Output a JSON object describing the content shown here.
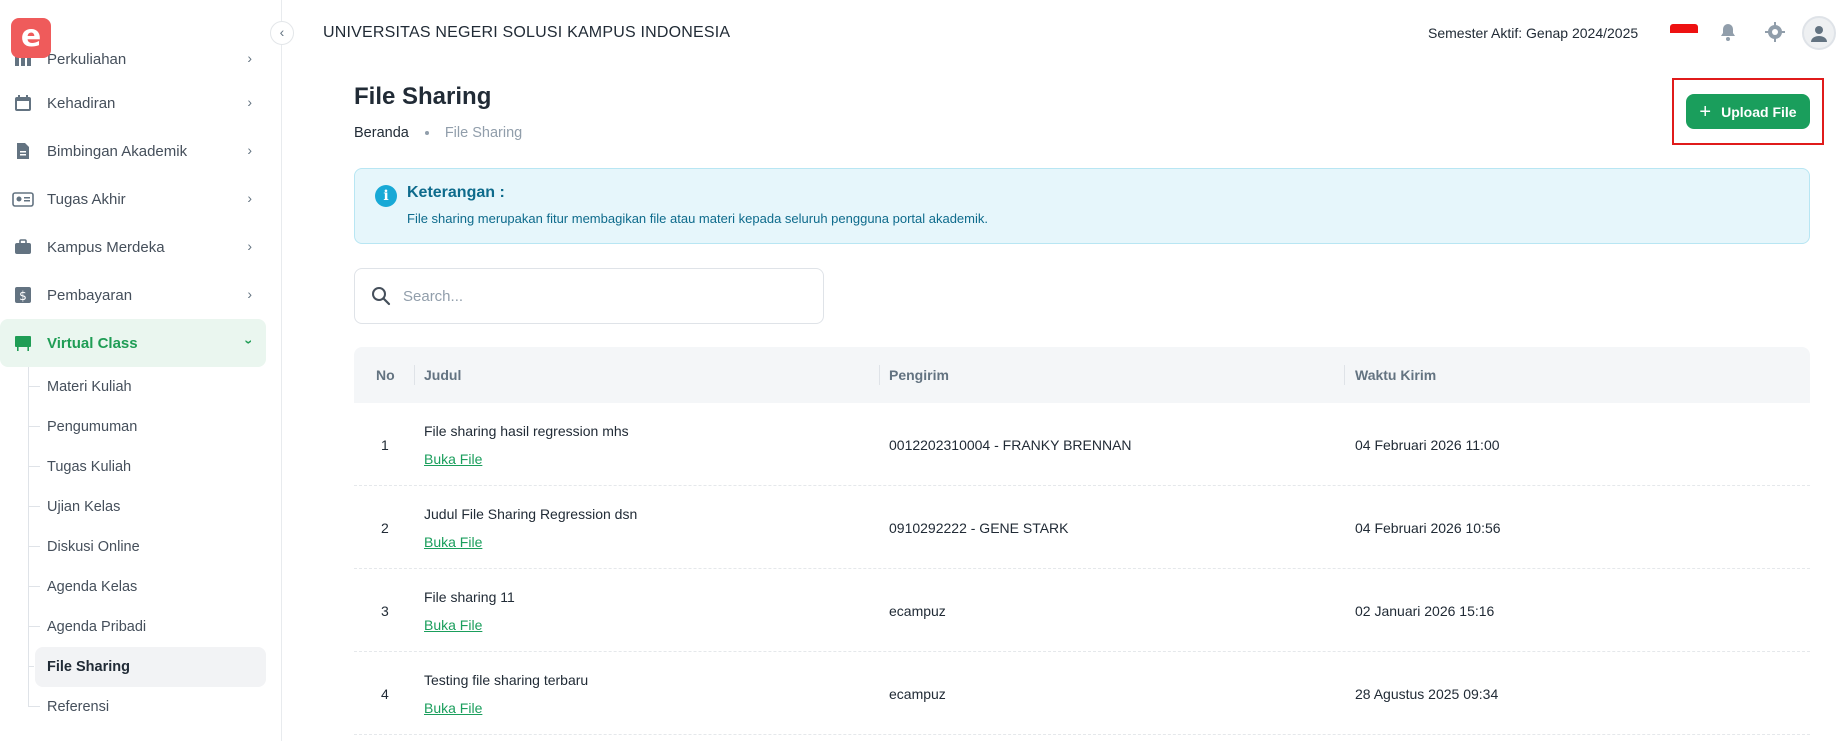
{
  "app": {
    "logo_letter": "e",
    "title": "UNIVERSITAS NEGERI SOLUSI KAMPUS INDONESIA",
    "semester": "Semester Aktif: Genap 2024/2025"
  },
  "sidebar": {
    "items": [
      {
        "label": "Perkuliahan",
        "icon": "columns-icon"
      },
      {
        "label": "Kehadiran",
        "icon": "calendar-icon"
      },
      {
        "label": "Bimbingan Akademik",
        "icon": "document-icon"
      },
      {
        "label": "Tugas Akhir",
        "icon": "id-card-icon"
      },
      {
        "label": "Kampus Merdeka",
        "icon": "briefcase-icon"
      },
      {
        "label": "Pembayaran",
        "icon": "dollar-icon"
      },
      {
        "label": "Virtual Class",
        "icon": "presentation-board-icon"
      }
    ],
    "submenu": [
      {
        "label": "Materi Kuliah"
      },
      {
        "label": "Pengumuman"
      },
      {
        "label": "Tugas Kuliah"
      },
      {
        "label": "Ujian Kelas"
      },
      {
        "label": "Diskusi Online"
      },
      {
        "label": "Agenda Kelas"
      },
      {
        "label": "Agenda Pribadi"
      },
      {
        "label": "File Sharing"
      },
      {
        "label": "Referensi"
      }
    ]
  },
  "page": {
    "title": "File Sharing",
    "breadcrumb_home": "Beranda",
    "breadcrumb_current": "File Sharing",
    "upload_label": "Upload File"
  },
  "info": {
    "title": "Keterangan :",
    "text": "File sharing merupakan fitur membagikan file atau materi kepada seluruh pengguna portal akademik."
  },
  "search": {
    "placeholder": "Search..."
  },
  "table": {
    "headers": [
      "No",
      "Judul",
      "Pengirim",
      "Waktu Kirim"
    ],
    "rows": [
      {
        "no": "1",
        "title": "File sharing hasil regression mhs",
        "link": "Buka File",
        "sender": "0012202310004 - FRANKY BRENNAN",
        "time": "04 Februari 2026 11:00"
      },
      {
        "no": "2",
        "title": "Judul File Sharing Regression dsn",
        "link": "Buka File",
        "sender": "0910292222 - GENE STARK",
        "time": "04 Februari 2026 10:56"
      },
      {
        "no": "3",
        "title": "File sharing 11",
        "link": "Buka File",
        "sender": "ecampuz",
        "time": "02 Januari 2026 15:16"
      },
      {
        "no": "4",
        "title": "Testing file sharing terbaru",
        "link": "Buka File",
        "sender": "ecampuz",
        "time": "28 Agustus 2025 09:34"
      }
    ]
  },
  "colors": {
    "accent": "#1a9e5c",
    "highlight": "#e01b1b",
    "info_bg": "#e6f6fb",
    "logo": "#ef5b5b"
  }
}
